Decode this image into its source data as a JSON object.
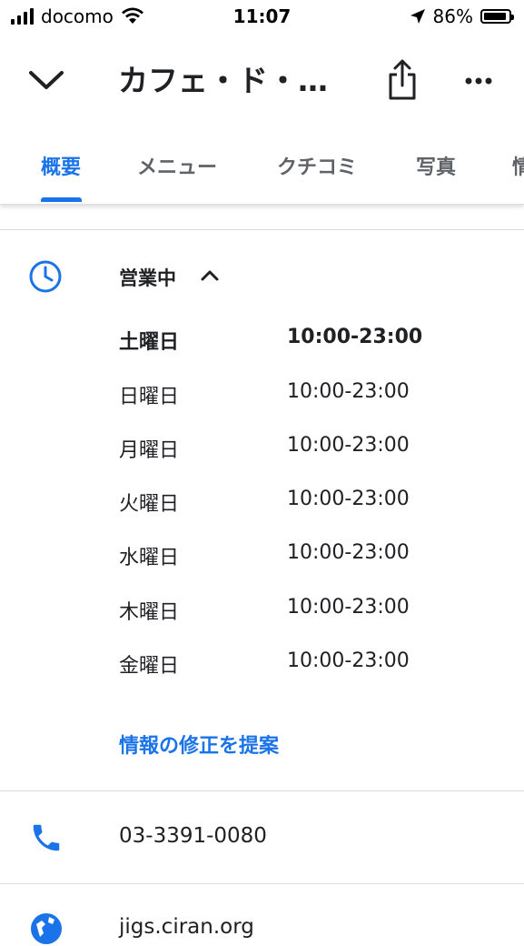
{
  "status_bar": {
    "carrier": "docomo",
    "time": "11:07",
    "battery": "86%"
  },
  "header": {
    "title": "カフェ・ド・…"
  },
  "tabs": [
    {
      "label": "概要",
      "active": true
    },
    {
      "label": "メニュー"
    },
    {
      "label": "クチコミ"
    },
    {
      "label": "写真"
    },
    {
      "label": "情"
    }
  ],
  "hours": {
    "status": "営業中",
    "rows": [
      {
        "day": "土曜日",
        "time": "10:00-23:00",
        "today": true
      },
      {
        "day": "日曜日",
        "time": "10:00-23:00"
      },
      {
        "day": "月曜日",
        "time": "10:00-23:00"
      },
      {
        "day": "火曜日",
        "time": "10:00-23:00"
      },
      {
        "day": "水曜日",
        "time": "10:00-23:00"
      },
      {
        "day": "木曜日",
        "time": "10:00-23:00"
      },
      {
        "day": "金曜日",
        "time": "10:00-23:00"
      }
    ],
    "suggest_edit": "情報の修正を提案"
  },
  "contact": {
    "phone": "03-3391-0080",
    "website": "jigs.ciran.org"
  },
  "colors": {
    "accent": "#1a73e8",
    "text": "#202124",
    "muted": "#5f6368",
    "divider": "#dadce0"
  }
}
